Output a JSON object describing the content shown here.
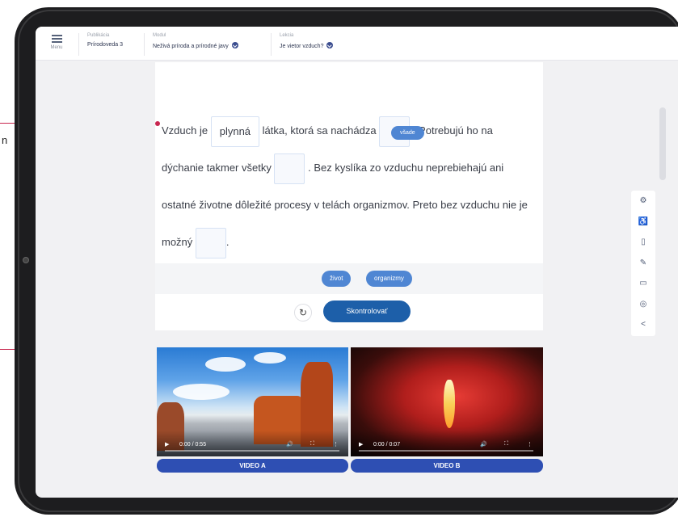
{
  "annotation": {
    "text": "n"
  },
  "topbar": {
    "menu_label": "Menu",
    "publication_label": "Publikácia",
    "publication_value": "Prírodoveda 3",
    "module_label": "Modul",
    "module_value": "Neživá príroda a prírodné javy",
    "lesson_label": "Lekcia",
    "lesson_value": "Je vietor vzduch?"
  },
  "exercise": {
    "part1": "Vzduch je",
    "gap1_value": "plynná",
    "part2": "látka, ktorá sa nachádza",
    "part3": ". Potrebujú ho na dýchanie takmer všetky",
    "part4": ". Bez kyslíka zo vzduchu neprebiehajú ani ostatné životne dôležité procesy v telách organizmov. Preto bez vzduchu nie je možný",
    "part5": ".",
    "dragging_chip": "všade",
    "chips": [
      "život",
      "organizmy"
    ],
    "check_button": "Skontrolovať"
  },
  "side_tools": [
    "gear-icon",
    "accessibility-icon",
    "bookmark-icon",
    "pencil-icon",
    "screen-icon",
    "target-icon",
    "share-icon"
  ],
  "videos": [
    {
      "label": "VIDEO A",
      "time": "0:00 / 0:55",
      "progress": 0
    },
    {
      "label": "VIDEO B",
      "time": "0:00 / 0:07",
      "progress": 0
    }
  ]
}
